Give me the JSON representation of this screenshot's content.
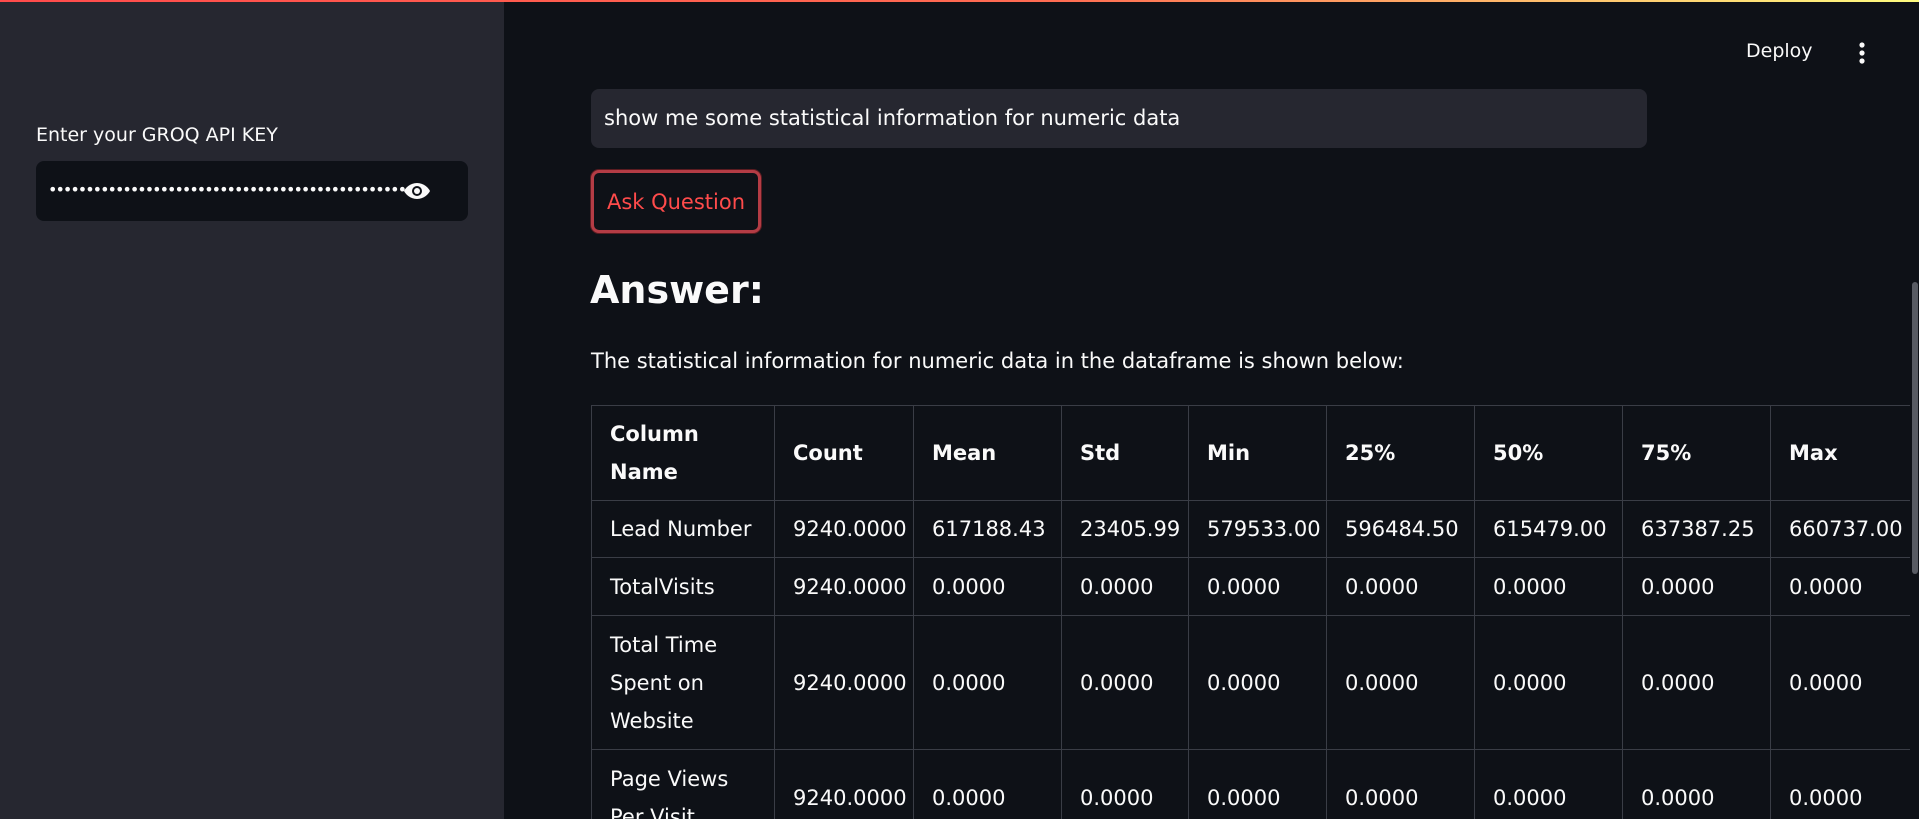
{
  "sidebar": {
    "api_key_label": "Enter your GROQ API KEY",
    "api_key_masked": "••••••••••••••••••••••••••••••••••••••••••••••••••••••••",
    "toggle_icon": "eye-icon"
  },
  "header": {
    "deploy_label": "Deploy",
    "menu_icon": "kebab-menu-icon"
  },
  "main": {
    "question_value": "show me some statistical information for numeric data",
    "ask_button_label": "Ask Question",
    "answer_heading": "Answer:",
    "answer_text": "The statistical information for numeric data in the dataframe is shown below:",
    "table": {
      "headers": [
        "Column Name",
        "Count",
        "Mean",
        "Std",
        "Min",
        "25%",
        "50%",
        "75%",
        "Max"
      ],
      "rows": [
        [
          "Lead Number",
          "9240.0000",
          "617188.43",
          "23405.99",
          "579533.00",
          "596484.50",
          "615479.00",
          "637387.25",
          "660737.00"
        ],
        [
          "TotalVisits",
          "9240.0000",
          "0.0000",
          "0.0000",
          "0.0000",
          "0.0000",
          "0.0000",
          "0.0000",
          "0.0000"
        ],
        [
          "Total Time Spent on Website",
          "9240.0000",
          "0.0000",
          "0.0000",
          "0.0000",
          "0.0000",
          "0.0000",
          "0.0000",
          "0.0000"
        ],
        [
          "Page Views Per Visit",
          "9240.0000",
          "0.0000",
          "0.0000",
          "0.0000",
          "0.0000",
          "0.0000",
          "0.0000",
          "0.0000"
        ]
      ]
    }
  },
  "colors": {
    "accent": "#ff4b4b",
    "background": "#0e1117",
    "sidebar": "#262730"
  }
}
